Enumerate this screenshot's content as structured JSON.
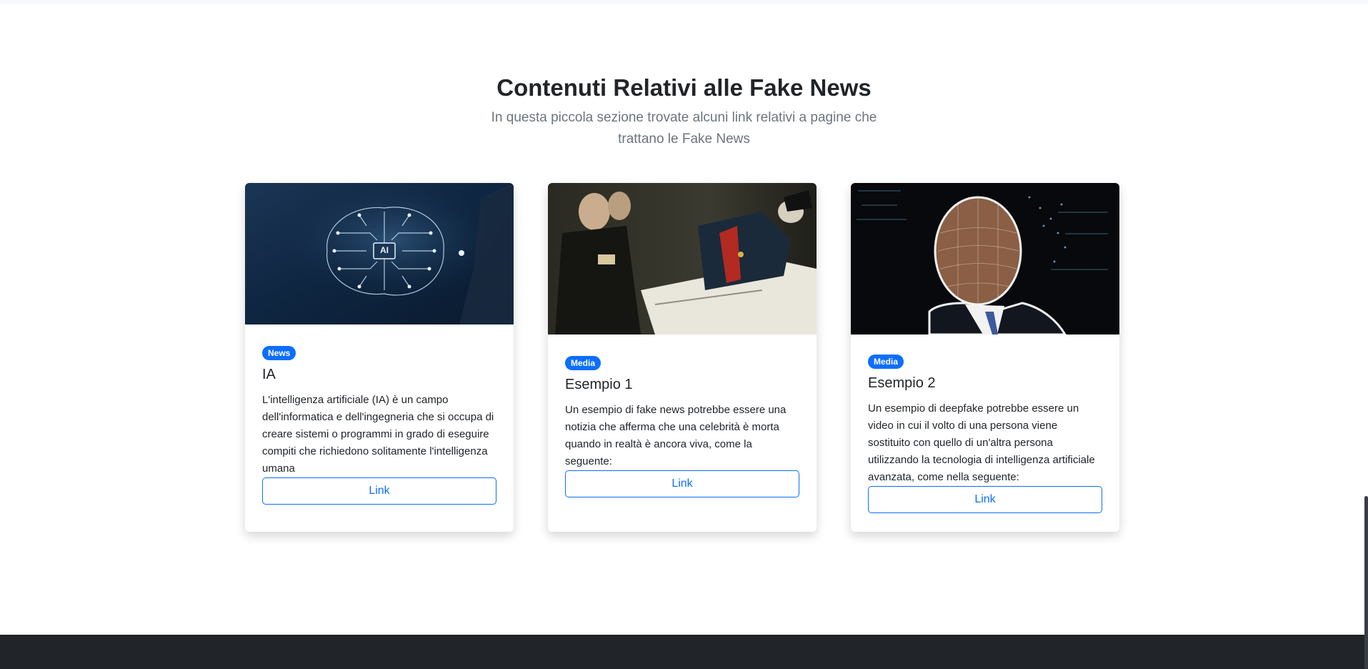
{
  "section": {
    "title": "Contenuti Relativi alle Fake News",
    "subtitle": "In questa piccola sezione trovate alcuni link relativi a pagine che trattano le Fake News"
  },
  "cards": [
    {
      "badge": "News",
      "title": "IA",
      "text": "L'intelligenza artificiale (IA) è un campo dell'informatica e dell'ingegneria che si occupa di creare sistemi o programmi in grado di eseguire compiti che richiedono solitamente l'intelligenza umana",
      "button": "Link",
      "image_alt": "AI brain circuit illustration",
      "image_label": "AI"
    },
    {
      "badge": "Media",
      "title": "Esempio 1",
      "text": "Un esempio di fake news potrebbe essere una notizia che afferma che una celebrità è morta quando in realtà è ancora viva, come la seguente:",
      "button": "Link",
      "image_alt": "Painting of a general on his deathbed"
    },
    {
      "badge": "Media",
      "title": "Esempio 2",
      "text": "Un esempio di deepfake potrebbe essere un video in cui il volto di una persona viene sostituito con quello di un'altra persona utilizzando la tecnologia di intelligenza artificiale avanzata, come nella seguente:",
      "button": "Link",
      "image_alt": "Face with digital mesh overlay"
    }
  ],
  "colors": {
    "accent": "#0d6efd",
    "footer": "#212529",
    "muted_text": "#6c757d"
  }
}
